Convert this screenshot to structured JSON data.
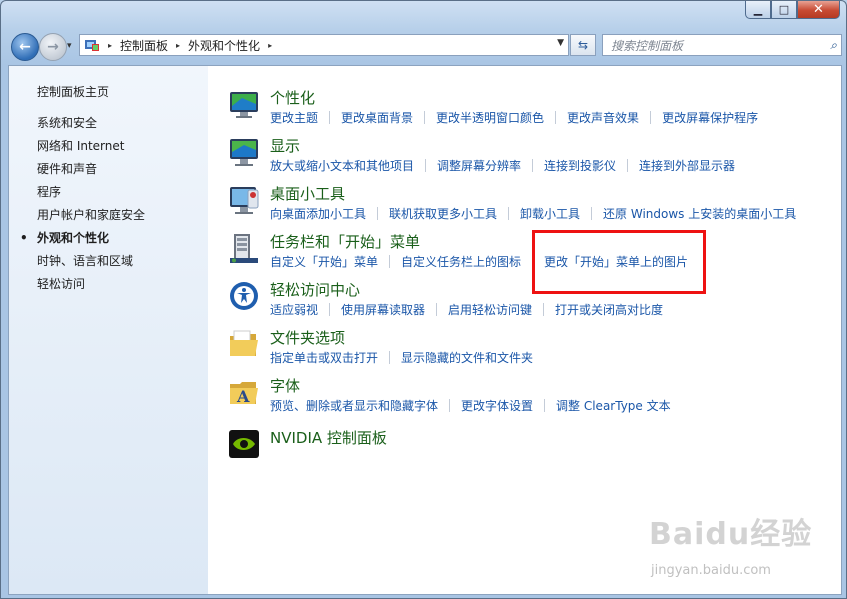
{
  "window": {
    "minimize": "▁",
    "maximize": "□",
    "close": "✕"
  },
  "nav": {
    "back_icon": "back-arrow-icon",
    "forward_icon": "forward-arrow-icon",
    "back_glyph": "←",
    "forward_glyph": "→",
    "history_glyph": "▾"
  },
  "address": {
    "breadcrumbs": [
      "控制面板",
      "外观和个性化"
    ],
    "separator": "▸",
    "dropdown": "▼"
  },
  "refresh_glyph": "⇆",
  "search": {
    "placeholder": "搜索控制面板",
    "icon": "search-icon",
    "glyph": "⌕"
  },
  "sidebar": {
    "home": "控制面板主页",
    "items": [
      {
        "label": "系统和安全"
      },
      {
        "label": "网络和 Internet"
      },
      {
        "label": "硬件和声音"
      },
      {
        "label": "程序"
      },
      {
        "label": "用户帐户和家庭安全"
      },
      {
        "label": "外观和个性化",
        "active": true
      },
      {
        "label": "时钟、语言和区域"
      },
      {
        "label": "轻松访问"
      }
    ]
  },
  "categories": [
    {
      "title": "个性化",
      "icon": "personalization-icon",
      "links": [
        "更改主题",
        "更改桌面背景",
        "更改半透明窗口颜色",
        "更改声音效果",
        "更改屏幕保护程序"
      ]
    },
    {
      "title": "显示",
      "icon": "display-icon",
      "links": [
        "放大或缩小文本和其他项目",
        "调整屏幕分辨率",
        "连接到投影仪",
        "连接到外部显示器"
      ]
    },
    {
      "title": "桌面小工具",
      "icon": "gadgets-icon",
      "links": [
        "向桌面添加小工具",
        "联机获取更多小工具",
        "卸载小工具",
        "还原 Windows 上安装的桌面小工具"
      ]
    },
    {
      "title": "任务栏和「开始」菜单",
      "icon": "taskbar-icon",
      "links": [
        "自定义「开始」菜单",
        "自定义任务栏上的图标",
        "更改「开始」菜单上的图片"
      ]
    },
    {
      "title": "轻松访问中心",
      "icon": "ease-of-access-icon",
      "links": [
        "适应弱视",
        "使用屏幕读取器",
        "启用轻松访问键",
        "打开或关闭高对比度"
      ]
    },
    {
      "title": "文件夹选项",
      "icon": "folder-icon",
      "links": [
        "指定单击或双击打开",
        "显示隐藏的文件和文件夹"
      ]
    },
    {
      "title": "字体",
      "icon": "fonts-icon",
      "links": [
        "预览、删除或者显示和隐藏字体",
        "更改字体设置",
        "调整 ClearType 文本"
      ]
    },
    {
      "title": "NVIDIA 控制面板",
      "icon": "nvidia-icon",
      "links": []
    }
  ],
  "watermark": {
    "logo": "Baidu经验",
    "url": "jingyan.baidu.com"
  },
  "colors": {
    "link": "#1a56a8",
    "category_title": "#1a5f1a",
    "highlight": "#ee1212"
  }
}
